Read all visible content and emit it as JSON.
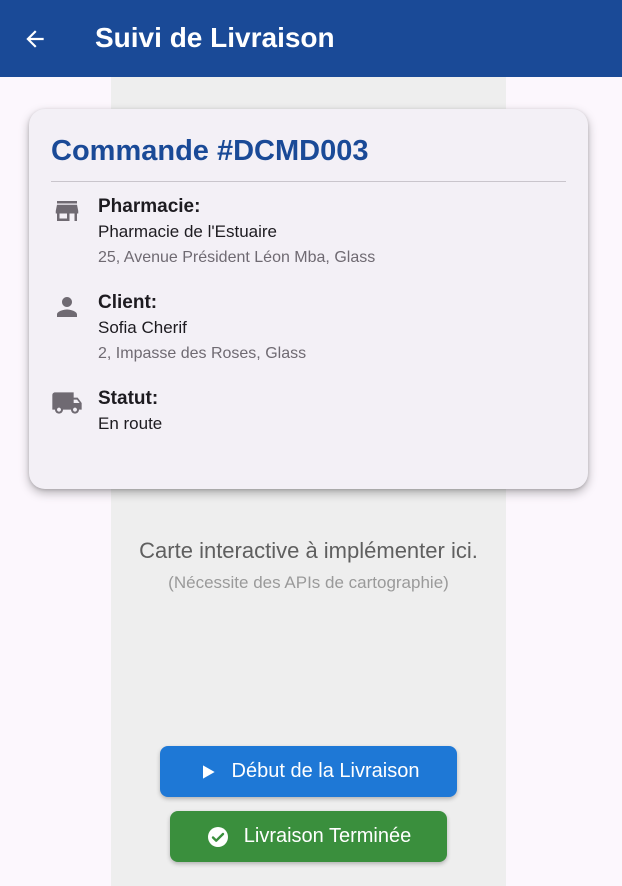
{
  "app_bar": {
    "title": "Suivi de Livraison",
    "back_icon": "arrow-back-icon",
    "color": "#1a4a97"
  },
  "order": {
    "title": "Commande #DCMD003",
    "pharmacy": {
      "icon": "store-icon",
      "label": "Pharmacie:",
      "name": "Pharmacie de l'Estuaire",
      "address": "25, Avenue Président Léon Mba, Glass"
    },
    "client": {
      "icon": "person-icon",
      "label": "Client:",
      "name": "Sofia Cherif",
      "address": "2, Impasse des Roses, Glass"
    },
    "status": {
      "icon": "truck-icon",
      "label": "Statut:",
      "value": "En route"
    }
  },
  "map": {
    "placeholder": "Carte interactive à implémenter ici.",
    "note": "(Nécessite des APIs de cartographie)"
  },
  "actions": {
    "start": {
      "label": "Début de la Livraison",
      "icon": "play-icon",
      "color": "#1e78d6"
    },
    "done": {
      "label": "Livraison Terminée",
      "icon": "check-circle-icon",
      "color": "#3a8f3d"
    }
  }
}
